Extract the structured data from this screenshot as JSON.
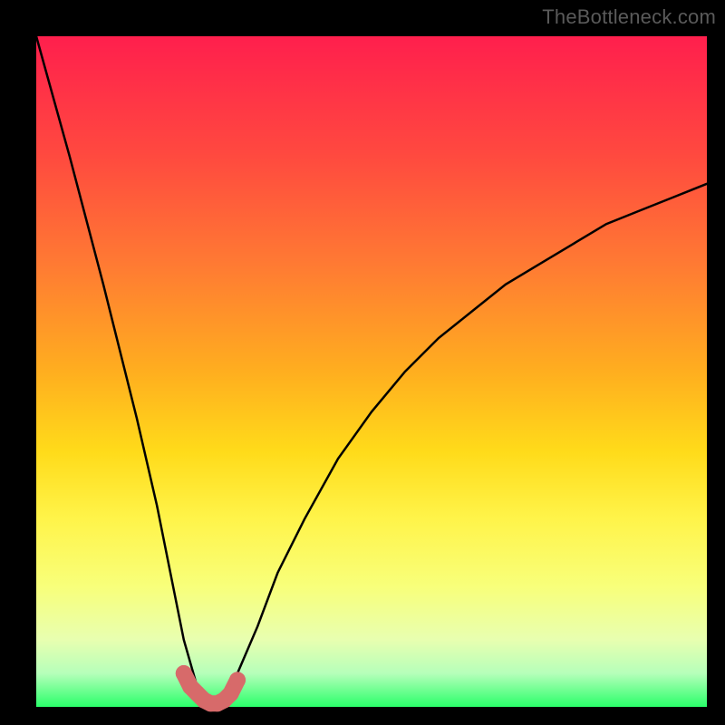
{
  "watermark": "TheBottleneck.com",
  "chart_data": {
    "type": "line",
    "title": "",
    "xlabel": "",
    "ylabel": "",
    "xlim": [
      0,
      100
    ],
    "ylim": [
      0,
      100
    ],
    "grid": false,
    "series": [
      {
        "name": "bottleneck-curve",
        "x": [
          0,
          5,
          10,
          15,
          18,
          20,
          22,
          24,
          25,
          26,
          27,
          28,
          30,
          33,
          36,
          40,
          45,
          50,
          55,
          60,
          65,
          70,
          75,
          80,
          85,
          90,
          95,
          100
        ],
        "values": [
          100,
          82,
          63,
          43,
          30,
          20,
          10,
          3,
          1,
          0,
          0,
          1,
          5,
          12,
          20,
          28,
          37,
          44,
          50,
          55,
          59,
          63,
          66,
          69,
          72,
          74,
          76,
          78
        ]
      },
      {
        "name": "highlight-range",
        "x": [
          22,
          23,
          24,
          25,
          26,
          27,
          28,
          29,
          30
        ],
        "values": [
          5,
          3,
          2,
          1,
          0.5,
          0.5,
          1,
          2,
          4
        ]
      }
    ],
    "background": {
      "type": "vertical-gradient",
      "stops": [
        {
          "pos": 0.0,
          "color": "#ff1f4d"
        },
        {
          "pos": 0.18,
          "color": "#ff4a3f"
        },
        {
          "pos": 0.34,
          "color": "#ff7a33"
        },
        {
          "pos": 0.5,
          "color": "#ffae1f"
        },
        {
          "pos": 0.62,
          "color": "#ffdb1a"
        },
        {
          "pos": 0.72,
          "color": "#fff44a"
        },
        {
          "pos": 0.82,
          "color": "#f8ff7a"
        },
        {
          "pos": 0.9,
          "color": "#e8ffb0"
        },
        {
          "pos": 0.95,
          "color": "#b6ffba"
        },
        {
          "pos": 1.0,
          "color": "#2aff6a"
        }
      ]
    },
    "frame_color": "#000000"
  }
}
